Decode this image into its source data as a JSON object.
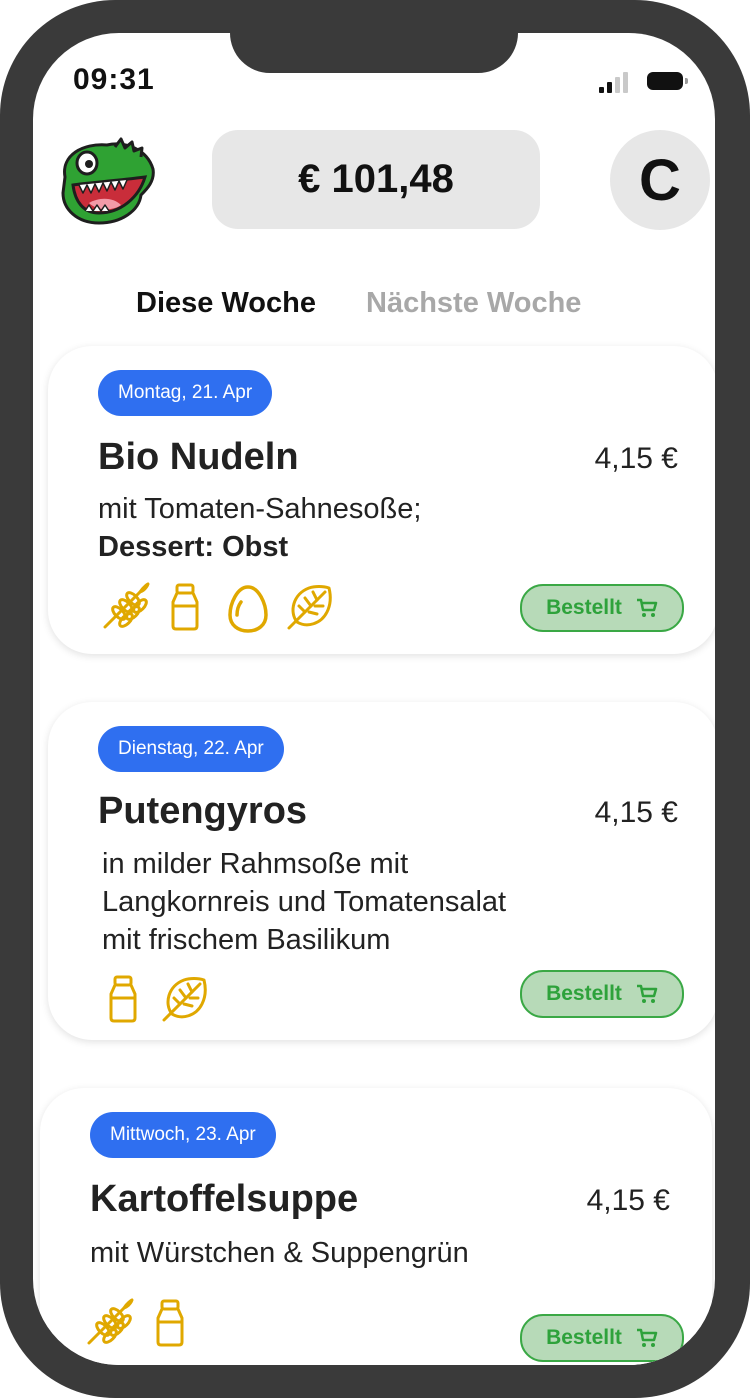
{
  "status_bar": {
    "time": "09:31"
  },
  "header": {
    "balance": "€ 101,48",
    "avatar_initial": "C"
  },
  "tabs": [
    {
      "label": "Diese Woche",
      "active": true
    },
    {
      "label": "Nächste Woche",
      "active": false
    }
  ],
  "meals": [
    {
      "date": "Montag, 21. Apr",
      "title": "Bio Nudeln",
      "price": "4,15 €",
      "description": "mit Tomaten-Sahnesoße;",
      "description_bold": "Dessert: Obst",
      "allergen_icons": [
        "wheat-icon",
        "milk-bottle-icon",
        "egg-icon",
        "leaf-icon"
      ],
      "order_label": "Bestellt"
    },
    {
      "date": "Dienstag, 22. Apr",
      "title": "Putengyros",
      "price": "4,15 €",
      "description_lines": [
        "in milder Rahmsoße mit",
        "Langkornreis und Tomatensalat",
        "mit frischem Basilikum"
      ],
      "allergen_icons": [
        "milk-bottle-icon",
        "leaf-icon"
      ],
      "order_label": "Bestellt"
    },
    {
      "date": "Mittwoch, 23. Apr",
      "title": "Kartoffelsuppe",
      "price": "4,15 €",
      "description": "mit Würstchen & Suppengrün",
      "allergen_icons": [
        "wheat-icon",
        "milk-bottle-icon"
      ],
      "order_label": "Bestellt"
    }
  ],
  "colors": {
    "frame": "#3a3a3a",
    "date_pill": "#2f6ff0",
    "allergen_icon": "#e0a800",
    "ordered_green": "#2ea23b",
    "ordered_bg": "#b7dab8"
  }
}
